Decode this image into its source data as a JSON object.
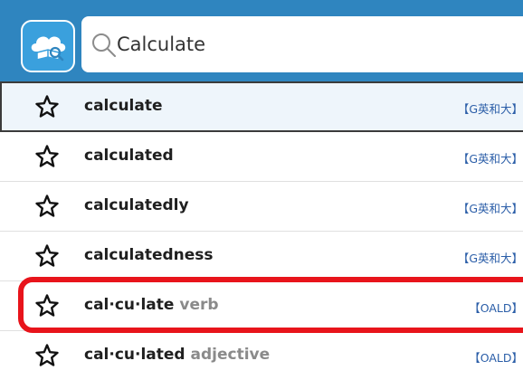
{
  "search": {
    "value": "Calculate",
    "logo_icon": "cloud-dictionary-icon",
    "search_icon": "search-icon"
  },
  "results": [
    {
      "headword": "calculate",
      "pos": "",
      "dictionary": "【G英和大】",
      "selected": true
    },
    {
      "headword": "calculated",
      "pos": "",
      "dictionary": "【G英和大】",
      "selected": false
    },
    {
      "headword": "calculatedly",
      "pos": "",
      "dictionary": "【G英和大】",
      "selected": false
    },
    {
      "headword": "calculatedness",
      "pos": "",
      "dictionary": "【G英和大】",
      "selected": false
    },
    {
      "headword": "cal·cu·late",
      "pos": "verb",
      "dictionary": "【OALD】",
      "selected": false
    },
    {
      "headword": "cal·cu·lated",
      "pos": "adjective",
      "dictionary": "【OALD】",
      "selected": false
    }
  ],
  "colors": {
    "header": "#2f85bf",
    "highlight": "#e8141b",
    "dictionary_tag": "#2b5ea8",
    "selected_row": "#eef5fb"
  }
}
